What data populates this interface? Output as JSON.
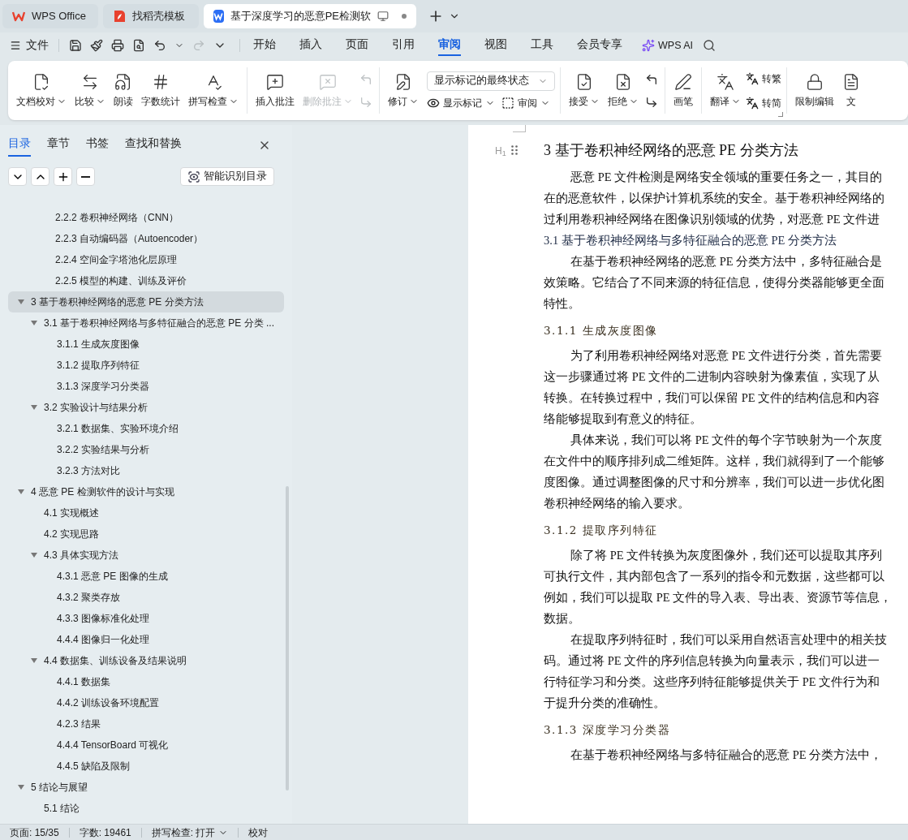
{
  "browser_tabs": [
    {
      "label": "WPS Office",
      "kind": "home",
      "selected": false
    },
    {
      "label": "找稻壳模板",
      "kind": "template",
      "selected": false
    },
    {
      "label": "基于深度学习的恶意PE检测软",
      "kind": "document",
      "selected": true,
      "unsaved": true
    }
  ],
  "menu": {
    "file": "文件",
    "tabs": [
      {
        "label": "开始",
        "selected": false
      },
      {
        "label": "插入",
        "selected": false
      },
      {
        "label": "页面",
        "selected": false
      },
      {
        "label": "引用",
        "selected": false
      },
      {
        "label": "审阅",
        "selected": true
      },
      {
        "label": "视图",
        "selected": false
      },
      {
        "label": "工具",
        "selected": false
      },
      {
        "label": "会员专享",
        "selected": false
      }
    ],
    "ai": "WPS AI"
  },
  "ribbon": [
    {
      "items": [
        {
          "kind": "big",
          "label": "文档校对",
          "menu": true,
          "disabled": false
        },
        {
          "kind": "big",
          "label": "比较",
          "menu": true,
          "disabled": false
        },
        {
          "kind": "big",
          "label": "朗读",
          "menu": false,
          "disabled": false
        },
        {
          "kind": "big",
          "label": "字数统计",
          "menu": false,
          "disabled": false
        },
        {
          "kind": "big",
          "label": "拼写检查",
          "menu": true,
          "disabled": false
        }
      ]
    },
    {
      "items": [
        {
          "kind": "big",
          "label": "插入批注",
          "menu": false,
          "disabled": false
        },
        {
          "kind": "big",
          "label": "删除批注",
          "menu": true,
          "disabled": true
        },
        {
          "kind": "iconpair",
          "disabled": true
        }
      ]
    },
    {
      "items": [
        {
          "kind": "big",
          "label": "修订",
          "menu": true,
          "disabled": false
        },
        {
          "kind": "display",
          "value": "显示标记的最终状态",
          "buttons": [
            {
              "label": "显示标记",
              "menu": true
            },
            {
              "label": "审阅",
              "menu": true
            }
          ]
        }
      ]
    },
    {
      "items": [
        {
          "kind": "big",
          "label": "接受",
          "menu": true,
          "disabled": false
        },
        {
          "kind": "big",
          "label": "拒绝",
          "menu": true,
          "disabled": false
        },
        {
          "kind": "iconpair",
          "disabled": false
        }
      ]
    },
    {
      "items": [
        {
          "kind": "big",
          "label": "画笔",
          "menu": false,
          "disabled": false
        }
      ]
    },
    {
      "items": [
        {
          "kind": "big",
          "label": "翻译",
          "menu": true,
          "disabled": false
        },
        {
          "kind": "smallpair",
          "buttons": [
            {
              "label": "转繁"
            },
            {
              "label": "转简"
            }
          ]
        }
      ],
      "launcher": true
    },
    {
      "items": [
        {
          "kind": "big",
          "label": "限制编辑",
          "menu": false,
          "disabled": false
        },
        {
          "kind": "big",
          "label": "文",
          "menu": false,
          "disabled": false
        }
      ]
    }
  ],
  "sidebar": {
    "tabs": [
      {
        "label": "目录",
        "selected": true
      },
      {
        "label": "章节",
        "selected": false
      },
      {
        "label": "书签",
        "selected": false
      },
      {
        "label": "查找和替换",
        "selected": false
      }
    ],
    "smart_button": "智能识别目录",
    "partial_items": [
      {
        "label": "2.2.2  卷积神经网络（CNN）"
      },
      {
        "label": "2.2.3  自动编码器（Autoencoder）"
      },
      {
        "label": "2.2.4  空间金字塔池化层原理"
      },
      {
        "label": "2.2.5  模型的构建、训练及评价"
      }
    ],
    "items": [
      {
        "label": "3  基于卷积神经网络的恶意 PE 分类方法",
        "expanded": true,
        "selected": true,
        "children": [
          {
            "label": "3.1  基于卷积神经网络与多特征融合的恶意 PE 分类 ...",
            "expanded": true,
            "selected": false,
            "children": [
              {
                "label": "3.1.1  生成灰度图像",
                "selected": false
              },
              {
                "label": "3.1.2  提取序列特征",
                "selected": false
              },
              {
                "label": "3.1.3  深度学习分类器",
                "selected": false
              }
            ]
          },
          {
            "label": "3.2  实验设计与结果分析",
            "expanded": true,
            "selected": false,
            "children": [
              {
                "label": "3.2.1  数据集、实验环境介绍",
                "selected": false
              },
              {
                "label": "3.2.2  实验结果与分析",
                "selected": false
              },
              {
                "label": "3.2.3  方法对比",
                "selected": false
              }
            ]
          }
        ]
      },
      {
        "label": "4  恶意 PE 检测软件的设计与实现",
        "expanded": true,
        "selected": false,
        "children": [
          {
            "label": "4.1  实现概述",
            "selected": false
          },
          {
            "label": "4.2  实现思路",
            "selected": false
          },
          {
            "label": "4.3 具体实现方法",
            "expanded": true,
            "selected": false,
            "children": [
              {
                "label": "4.3.1 恶意 PE 图像的生成",
                "selected": false
              },
              {
                "label": "4.3.2 聚类存放",
                "selected": false
              },
              {
                "label": "4.3.3 图像标准化处理",
                "selected": false
              },
              {
                "label": "4.4.4 图像归一化处理",
                "selected": false
              }
            ]
          },
          {
            "label": "4.4 数据集、训练设备及结果说明",
            "expanded": true,
            "selected": false,
            "children": [
              {
                "label": "4.4.1 数据集",
                "selected": false
              },
              {
                "label": "4.4.2 训练设备环境配置",
                "selected": false
              },
              {
                "label": "4.2.3  结果",
                "selected": false
              },
              {
                "label": "4.4.4 TensorBoard 可视化",
                "selected": false
              },
              {
                "label": "4.4.5  缺陷及限制",
                "selected": false
              }
            ]
          }
        ]
      },
      {
        "label": "5  结论与展望",
        "expanded": true,
        "selected": false,
        "children": [
          {
            "label": "5.1  结论",
            "selected": false
          }
        ]
      }
    ]
  },
  "document": {
    "heading_marker": "H$_{1}$",
    "blocks": [
      {
        "kind": "h1",
        "text": "3  基于卷积神经网络的恶意 PE 分类方法"
      },
      {
        "kind": "p",
        "lines": [
          "恶意 PE 文件检测是网络安全领域的重要任务之一，其目的",
          "在的恶意软件，以保护计算机系统的安全。基于卷积神经网络的",
          "过利用卷积神经网络在图像识别领域的优势，对恶意 PE 文件进"
        ]
      },
      {
        "kind": "h2",
        "text": "3.1  基于卷积神经网络与多特征融合的恶意 PE 分类方法"
      },
      {
        "kind": "p",
        "lines": [
          "在基于卷积神经网络的恶意 PE 分类方法中，多特征融合是",
          "效策略。它结合了不同来源的特征信息，使得分类器能够更全面",
          "特性。"
        ]
      },
      {
        "kind": "h3",
        "text": "3.1.1 生成灰度图像"
      },
      {
        "kind": "p",
        "lines": [
          "为了利用卷积神经网络对恶意 PE 文件进行分类，首先需要",
          "这一步骤通过将 PE 文件的二进制内容映射为像素值，实现了从",
          "转换。在转换过程中，我们可以保留 PE 文件的结构信息和内容",
          "络能够提取到有意义的特征。"
        ]
      },
      {
        "kind": "p",
        "lines": [
          "具体来说，我们可以将 PE 文件的每个字节映射为一个灰度",
          "在文件中的顺序排列成二维矩阵。这样，我们就得到了一个能够",
          "度图像。通过调整图像的尺寸和分辨率，我们可以进一步优化图",
          "卷积神经网络的输入要求。"
        ]
      },
      {
        "kind": "h3",
        "text": "3.1.2 提取序列特征"
      },
      {
        "kind": "p",
        "lines": [
          "除了将 PE 文件转换为灰度图像外，我们还可以提取其序列",
          "可执行文件，其内部包含了一系列的指令和元数据，这些都可以",
          "例如，我们可以提取 PE 文件的导入表、导出表、资源节等信息，",
          "数据。"
        ]
      },
      {
        "kind": "p",
        "lines": [
          "在提取序列特征时，我们可以采用自然语言处理中的相关技",
          "码。通过将 PE 文件的序列信息转换为向量表示，我们可以进一",
          "行特征学习和分类。这些序列特征能够提供关于 PE 文件行为和",
          "于提升分类的准确性。"
        ]
      },
      {
        "kind": "h3",
        "text": "3.1.3 深度学习分类器"
      },
      {
        "kind": "p",
        "lines": [
          "在基于卷积神经网络与多特征融合的恶意 PE 分类方法中，"
        ]
      }
    ]
  },
  "status_bar": [
    {
      "kind": "text",
      "label": "页面: 15/35"
    },
    {
      "kind": "text",
      "label": "字数: 19461"
    },
    {
      "kind": "menu",
      "label": "拼写检查: 打开"
    },
    {
      "kind": "text",
      "label": "校对"
    }
  ]
}
